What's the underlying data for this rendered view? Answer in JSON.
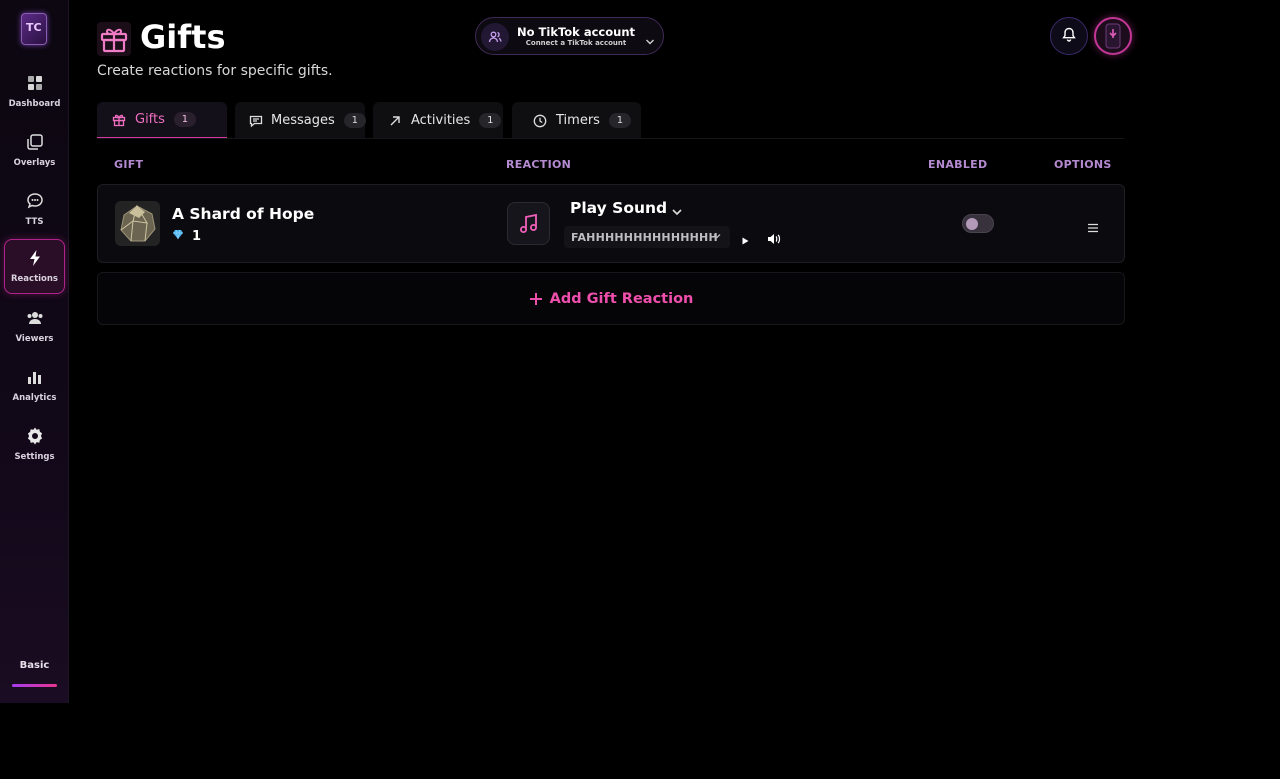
{
  "sidebar": {
    "logo_text": "TC",
    "items": [
      {
        "label": "Dashboard",
        "icon": "dashboard-icon"
      },
      {
        "label": "Overlays",
        "icon": "overlays-icon"
      },
      {
        "label": "TTS",
        "icon": "chat-bubble-icon"
      },
      {
        "label": "Reactions",
        "icon": "lightning-icon"
      },
      {
        "label": "Viewers",
        "icon": "users-icon"
      },
      {
        "label": "Analytics",
        "icon": "bar-chart-icon"
      },
      {
        "label": "Settings",
        "icon": "gear-icon"
      }
    ],
    "active": "Reactions",
    "plan_label": "Basic"
  },
  "header": {
    "title": "Gifts",
    "subtitle": "Create reactions for specific gifts."
  },
  "account": {
    "title": "No TikTok account",
    "subtitle": "Connect a TikTok account"
  },
  "tabs": [
    {
      "label": "Gifts",
      "count": "1",
      "icon": "gift-icon"
    },
    {
      "label": "Messages",
      "count": "1",
      "icon": "message-icon"
    },
    {
      "label": "Activities",
      "count": "1",
      "icon": "arrow-up-right-icon"
    },
    {
      "label": "Timers",
      "count": "1",
      "icon": "clock-icon"
    }
  ],
  "table": {
    "headers": {
      "gift": "GIFT",
      "reaction": "REACTION",
      "enabled": "ENABLED",
      "options": "OPTIONS"
    },
    "rows": [
      {
        "gift_name": "A Shard of Hope",
        "gift_cost": "1",
        "reaction_type": "Play Sound",
        "sound": "FAHHHHHHHHHHHHHH",
        "enabled": false
      }
    ]
  },
  "add_button": "Add Gift Reaction",
  "colors": {
    "accent": "#ee4fac",
    "header_text": "#b48ad0",
    "background": "#000000"
  }
}
